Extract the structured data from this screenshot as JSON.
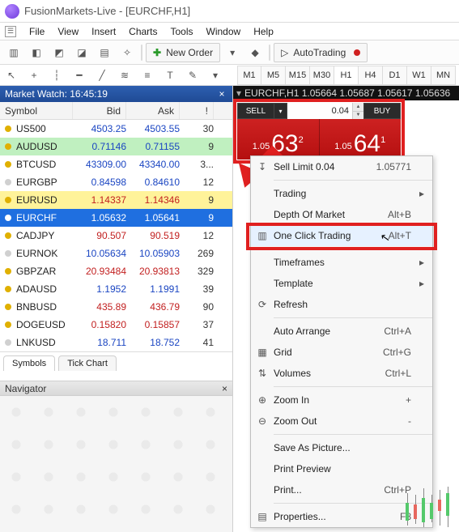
{
  "window": {
    "title": "FusionMarkets-Live - [EURCHF,H1]"
  },
  "menubar": {
    "items": [
      "File",
      "View",
      "Insert",
      "Charts",
      "Tools",
      "Window",
      "Help"
    ]
  },
  "toolbar": {
    "new_order": "New Order",
    "autotrading": "AutoTrading"
  },
  "timeframes": [
    "M1",
    "M5",
    "M15",
    "M30",
    "H1",
    "H4",
    "D1",
    "W1",
    "MN"
  ],
  "selected_tf": "H1",
  "market_watch": {
    "title": "Market Watch: 16:45:19",
    "headers": {
      "symbol": "Symbol",
      "bid": "Bid",
      "ask": "Ask",
      "ex": "!"
    },
    "rows": [
      {
        "dot": "#e0b000",
        "sym": "US500",
        "bid": "4503.25",
        "ask": "4503.55",
        "ex": "30",
        "cls": "blue"
      },
      {
        "dot": "#e0b000",
        "sym": "AUDUSD",
        "bid": "0.71146",
        "ask": "0.71155",
        "ex": "9",
        "cls": "blue",
        "row": "hl-green"
      },
      {
        "dot": "#e0b000",
        "sym": "BTCUSD",
        "bid": "43309.00",
        "ask": "43340.00",
        "ex": "3...",
        "cls": "blue"
      },
      {
        "dot": "#d0d0d0",
        "sym": "EURGBP",
        "bid": "0.84598",
        "ask": "0.84610",
        "ex": "12",
        "cls": "blue"
      },
      {
        "dot": "#e0b000",
        "sym": "EURUSD",
        "bid": "1.14337",
        "ask": "1.14346",
        "ex": "9",
        "cls": "red",
        "row": "hl-yellow"
      },
      {
        "dot": "#fff",
        "sym": "EURCHF",
        "bid": "1.05632",
        "ask": "1.05641",
        "ex": "9",
        "cls": "",
        "row": "selected"
      },
      {
        "dot": "#e0b000",
        "sym": "CADJPY",
        "bid": "90.507",
        "ask": "90.519",
        "ex": "12",
        "cls": "red"
      },
      {
        "dot": "#d0d0d0",
        "sym": "EURNOK",
        "bid": "10.05634",
        "ask": "10.05903",
        "ex": "269",
        "cls": "blue"
      },
      {
        "dot": "#e0b000",
        "sym": "GBPZAR",
        "bid": "20.93484",
        "ask": "20.93813",
        "ex": "329",
        "cls": "red"
      },
      {
        "dot": "#e0b000",
        "sym": "ADAUSD",
        "bid": "1.1952",
        "ask": "1.1991",
        "ex": "39",
        "cls": "blue"
      },
      {
        "dot": "#e0b000",
        "sym": "BNBUSD",
        "bid": "435.89",
        "ask": "436.79",
        "ex": "90",
        "cls": "red"
      },
      {
        "dot": "#e0b000",
        "sym": "DOGEUSD",
        "bid": "0.15820",
        "ask": "0.15857",
        "ex": "37",
        "cls": "red"
      },
      {
        "dot": "#d0d0d0",
        "sym": "LNKUSD",
        "bid": "18.711",
        "ask": "18.752",
        "ex": "41",
        "cls": "blue"
      }
    ],
    "tabs": {
      "symbols": "Symbols",
      "tick": "Tick Chart"
    }
  },
  "navigator": {
    "title": "Navigator"
  },
  "chart": {
    "header": "EURCHF,H1   1.05664 1.05687 1.05617 1.05636"
  },
  "one_click": {
    "sell": "SELL",
    "buy": "BUY",
    "volume": "0.04",
    "price_small": "1.05",
    "sell_big": "63",
    "sell_sup": "2",
    "buy_big": "64",
    "buy_sup": "1"
  },
  "context_menu": {
    "items": [
      {
        "icon": "↧",
        "label": "Sell Limit 0.04",
        "shortcut": "1.05771",
        "arrow": ""
      },
      {
        "sep": true
      },
      {
        "icon": "",
        "label": "Trading",
        "shortcut": "",
        "arrow": "▸"
      },
      {
        "icon": "",
        "label": "Depth Of Market",
        "shortcut": "Alt+B",
        "arrow": ""
      },
      {
        "icon": "▥",
        "label": "One Click Trading",
        "shortcut": "Alt+T",
        "arrow": "",
        "hl": true
      },
      {
        "sep": true
      },
      {
        "icon": "",
        "label": "Timeframes",
        "shortcut": "",
        "arrow": "▸"
      },
      {
        "icon": "",
        "label": "Template",
        "shortcut": "",
        "arrow": "▸"
      },
      {
        "icon": "⟳",
        "label": "Refresh",
        "shortcut": "",
        "arrow": ""
      },
      {
        "sep": true
      },
      {
        "icon": "",
        "label": "Auto Arrange",
        "shortcut": "Ctrl+A",
        "arrow": ""
      },
      {
        "icon": "▦",
        "label": "Grid",
        "shortcut": "Ctrl+G",
        "arrow": ""
      },
      {
        "icon": "⇅",
        "label": "Volumes",
        "shortcut": "Ctrl+L",
        "arrow": ""
      },
      {
        "sep": true
      },
      {
        "icon": "⊕",
        "label": "Zoom In",
        "shortcut": "+",
        "arrow": ""
      },
      {
        "icon": "⊖",
        "label": "Zoom Out",
        "shortcut": "-",
        "arrow": ""
      },
      {
        "sep": true
      },
      {
        "icon": "",
        "label": "Save As Picture...",
        "shortcut": "",
        "arrow": ""
      },
      {
        "icon": "",
        "label": "Print Preview",
        "shortcut": "",
        "arrow": ""
      },
      {
        "icon": "",
        "label": "Print...",
        "shortcut": "Ctrl+P",
        "arrow": ""
      },
      {
        "sep": true
      },
      {
        "icon": "▤",
        "label": "Properties...",
        "shortcut": "F8",
        "arrow": ""
      }
    ]
  }
}
